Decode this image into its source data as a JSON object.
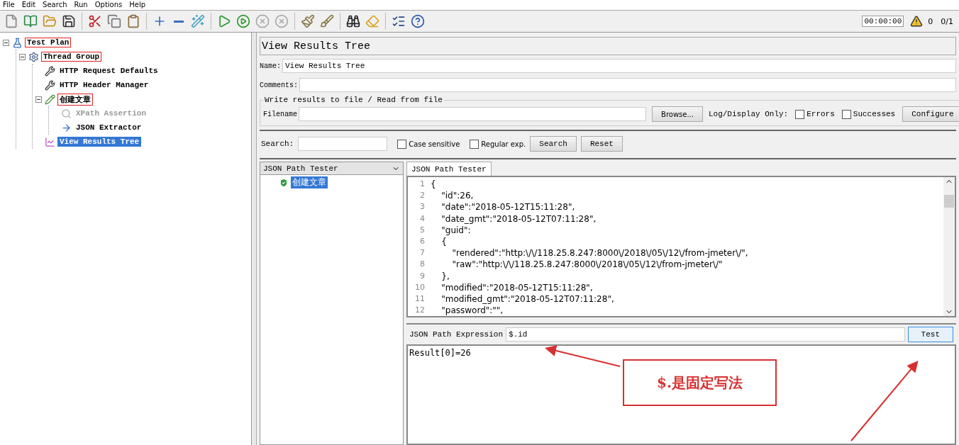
{
  "menu": [
    "File",
    "Edit",
    "Search",
    "Run",
    "Options",
    "Help"
  ],
  "status": {
    "timer": "00:00:00",
    "warnings": "0",
    "threads": "0/1"
  },
  "tree": [
    {
      "label": "Test Plan",
      "kind": "plan",
      "highlighted": true,
      "expanded": true,
      "selected": false,
      "disabled": false,
      "children": [
        {
          "label": "Thread Group",
          "kind": "thread",
          "highlighted": true,
          "expanded": true,
          "selected": false,
          "disabled": false,
          "children": [
            {
              "label": "HTTP Request Defaults",
              "kind": "config",
              "highlighted": false,
              "selected": false,
              "disabled": false
            },
            {
              "label": "HTTP Header Manager",
              "kind": "config",
              "highlighted": false,
              "selected": false,
              "disabled": false
            },
            {
              "label": "创建文章",
              "kind": "sampler",
              "highlighted": true,
              "expanded": true,
              "selected": false,
              "disabled": false,
              "children": [
                {
                  "label": "XPath Assertion",
                  "kind": "assertion",
                  "highlighted": false,
                  "selected": false,
                  "disabled": true
                },
                {
                  "label": "JSON Extractor",
                  "kind": "extractor",
                  "highlighted": false,
                  "selected": false,
                  "disabled": false
                }
              ]
            },
            {
              "label": "View Results Tree",
              "kind": "listener",
              "highlighted": false,
              "selected": true,
              "disabled": false
            }
          ]
        }
      ]
    }
  ],
  "panel": {
    "title": "View Results Tree",
    "name_label": "Name:",
    "name_value": "View Results Tree",
    "comments_label": "Comments:",
    "file_group": {
      "legend": "Write results to file / Read from file",
      "filename_label": "Filename",
      "browse": "Browse...",
      "log_label": "Log/Display Only:",
      "checkboxes": [
        {
          "label": "Errors",
          "checked": false
        },
        {
          "label": "Successes",
          "checked": false
        }
      ],
      "configure": "Configure"
    },
    "search": {
      "label": "Search:",
      "checkboxes": [
        {
          "label": "Case sensitive",
          "checked": false
        },
        {
          "label": "Regular exp.",
          "checked": false
        }
      ],
      "search_button": "Search",
      "reset_button": "Reset"
    }
  },
  "renderer": {
    "value": "JSON Path Tester",
    "results": [
      {
        "label": "创建文章",
        "selected": true
      }
    ]
  },
  "tester": {
    "tabs": [
      {
        "label": "JSON Path Tester",
        "selected": true
      }
    ],
    "lines": [
      {
        "number": "1",
        "text": "{"
      },
      {
        "number": "2",
        "text": "    \"id\":26,"
      },
      {
        "number": "3",
        "text": "    \"date\":\"2018-05-12T15:11:28\","
      },
      {
        "number": "4",
        "text": "    \"date_gmt\":\"2018-05-12T07:11:28\","
      },
      {
        "number": "5",
        "text": "    \"guid\":"
      },
      {
        "number": "6",
        "text": "    {"
      },
      {
        "number": "7",
        "text": "        \"rendered\":\"http:\\/\\/118.25.8.247:8000\\/2018\\/05\\/12\\/from-jmeter\\/\","
      },
      {
        "number": "8",
        "text": "        \"raw\":\"http:\\/\\/118.25.8.247:8000\\/2018\\/05\\/12\\/from-jmeter\\/\""
      },
      {
        "number": "9",
        "text": "    },"
      },
      {
        "number": "10",
        "text": "    \"modified\":\"2018-05-12T15:11:28\","
      },
      {
        "number": "11",
        "text": "    \"modified_gmt\":\"2018-05-12T07:11:28\","
      },
      {
        "number": "12",
        "text": "    \"password\":\"\","
      }
    ],
    "expression_label": "JSON Path Expression",
    "expression": "$.id",
    "test_button": "Test",
    "result": "Result[0]=26"
  },
  "annotation": {
    "callout": "$.是固定写法"
  }
}
